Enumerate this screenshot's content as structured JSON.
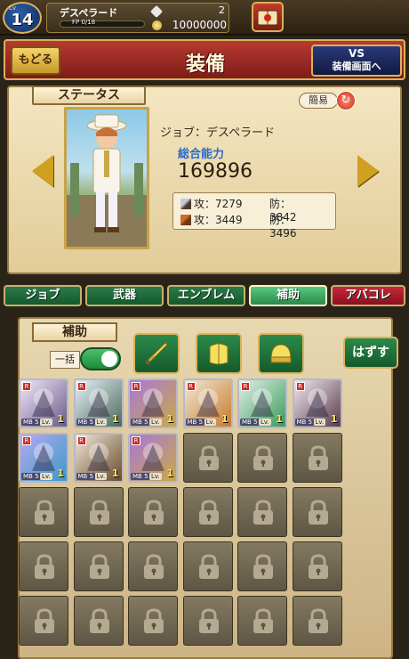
{
  "topbar": {
    "level_prefix": "Lv",
    "level": "14",
    "player_name": "デスペラード",
    "fp_label": "FP 0/18",
    "fp_progress": 0.0,
    "gem_count": "2",
    "gold_count": "10000000"
  },
  "header": {
    "back_label": "もどる",
    "title": "装備",
    "vs_label": "VS",
    "vs_sub": "装備画面へ"
  },
  "status": {
    "tag": "ステータス",
    "simple_label": "簡易",
    "job_line": "ジョブ：デスペラード",
    "power_label": "総合能力",
    "power_value": "169896",
    "phys_atk": "攻：7279",
    "phys_def": "防：3842",
    "mag_atk": "攻：3449",
    "mag_def": "防：3496"
  },
  "tabs": [
    {
      "label": "ジョブ"
    },
    {
      "label": "武器"
    },
    {
      "label": "エンブレム"
    },
    {
      "label": "補助"
    },
    {
      "label": "アバコレ"
    }
  ],
  "equip": {
    "tag": "補助",
    "bulk_label": "一括",
    "bulk_on": true,
    "remove_label": "はずす"
  },
  "items": [
    {
      "mb": "MB 5",
      "lv_label": "Lv.",
      "lv": "1",
      "colors": [
        "#f0e8f8",
        "#6a5a8a"
      ]
    },
    {
      "mb": "MB 5",
      "lv_label": "Lv.",
      "lv": "1",
      "colors": [
        "#e8f0f8",
        "#4a6a5a"
      ]
    },
    {
      "mb": "MB 5",
      "lv_label": "Lv.",
      "lv": "1",
      "colors": [
        "#a878d8",
        "#c8a848"
      ]
    },
    {
      "mb": "MB 5",
      "lv_label": "Lv.",
      "lv": "1",
      "colors": [
        "#f0e8d8",
        "#c87a2a"
      ]
    },
    {
      "mb": "MB 5",
      "lv_label": "Lv.",
      "lv": "1",
      "colors": [
        "#e0f0e8",
        "#3a9a5a"
      ]
    },
    {
      "mb": "MB 5",
      "lv_label": "Lv.",
      "lv": "1",
      "colors": [
        "#f0e8f0",
        "#5a3a4a"
      ]
    },
    {
      "mb": "MB 5",
      "lv_label": "Lv.",
      "lv": "1",
      "colors": [
        "#b8a8f0",
        "#3a9ac8"
      ]
    },
    {
      "mb": "MB 5",
      "lv_label": "Lv.",
      "lv": "1",
      "colors": [
        "#f0e8d8",
        "#6a4a2a"
      ]
    },
    {
      "mb": "MB 5",
      "lv_label": "Lv.",
      "lv": "1",
      "colors": [
        "#a878d8",
        "#c8a848"
      ]
    }
  ],
  "grid": {
    "columns": 6,
    "rows": 5,
    "unlocked_count": 9
  }
}
